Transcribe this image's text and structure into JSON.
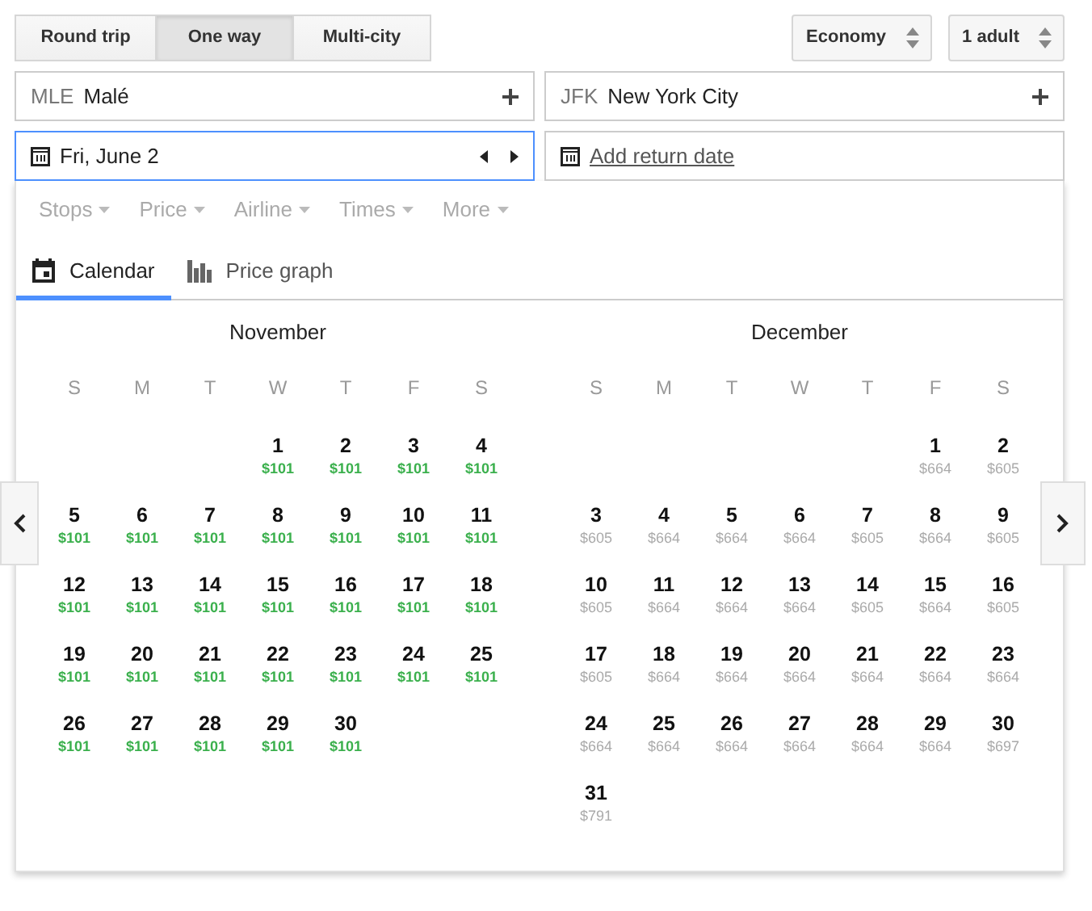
{
  "trip_types": [
    {
      "label": "Round trip",
      "selected": false
    },
    {
      "label": "One way",
      "selected": true
    },
    {
      "label": "Multi-city",
      "selected": false
    }
  ],
  "cabin": "Economy",
  "passengers": "1 adult",
  "origin": {
    "code": "MLE",
    "city": "Malé"
  },
  "destination": {
    "code": "JFK",
    "city": "New York City"
  },
  "depart_date": "Fri, June 2",
  "return_date": "Add return date",
  "filters": [
    "Stops",
    "Price",
    "Airline",
    "Times",
    "More"
  ],
  "view_tabs": [
    {
      "label": "Calendar",
      "kind": "calendar",
      "selected": true
    },
    {
      "label": "Price graph",
      "kind": "graph",
      "selected": false
    }
  ],
  "months": [
    {
      "name": "November",
      "weekdays": [
        "S",
        "M",
        "T",
        "W",
        "T",
        "F",
        "S"
      ],
      "weeks": [
        [
          {
            "day": "1",
            "price": "$101",
            "cheap": true
          },
          {
            "day": "2",
            "price": "$101",
            "cheap": true
          },
          {
            "day": "3",
            "price": "$101",
            "cheap": true
          },
          {
            "day": "4",
            "price": "$101",
            "cheap": true
          }
        ],
        [
          {
            "day": "5",
            "price": "$101",
            "cheap": true
          },
          {
            "day": "6",
            "price": "$101",
            "cheap": true
          },
          {
            "day": "7",
            "price": "$101",
            "cheap": true
          },
          {
            "day": "8",
            "price": "$101",
            "cheap": true
          },
          {
            "day": "9",
            "price": "$101",
            "cheap": true
          },
          {
            "day": "10",
            "price": "$101",
            "cheap": true
          },
          {
            "day": "11",
            "price": "$101",
            "cheap": true
          }
        ],
        [
          {
            "day": "12",
            "price": "$101",
            "cheap": true
          },
          {
            "day": "13",
            "price": "$101",
            "cheap": true
          },
          {
            "day": "14",
            "price": "$101",
            "cheap": true
          },
          {
            "day": "15",
            "price": "$101",
            "cheap": true
          },
          {
            "day": "16",
            "price": "$101",
            "cheap": true
          },
          {
            "day": "17",
            "price": "$101",
            "cheap": true
          },
          {
            "day": "18",
            "price": "$101",
            "cheap": true
          }
        ],
        [
          {
            "day": "19",
            "price": "$101",
            "cheap": true
          },
          {
            "day": "20",
            "price": "$101",
            "cheap": true
          },
          {
            "day": "21",
            "price": "$101",
            "cheap": true
          },
          {
            "day": "22",
            "price": "$101",
            "cheap": true
          },
          {
            "day": "23",
            "price": "$101",
            "cheap": true
          },
          {
            "day": "24",
            "price": "$101",
            "cheap": true
          },
          {
            "day": "25",
            "price": "$101",
            "cheap": true
          }
        ],
        [
          {
            "day": "26",
            "price": "$101",
            "cheap": true
          },
          {
            "day": "27",
            "price": "$101",
            "cheap": true
          },
          {
            "day": "28",
            "price": "$101",
            "cheap": true
          },
          {
            "day": "29",
            "price": "$101",
            "cheap": true
          },
          {
            "day": "30",
            "price": "$101",
            "cheap": true
          }
        ]
      ]
    },
    {
      "name": "December",
      "weekdays": [
        "S",
        "M",
        "T",
        "W",
        "T",
        "F",
        "S"
      ],
      "weeks": [
        [
          {
            "day": "1",
            "price": "$664",
            "cheap": false
          },
          {
            "day": "2",
            "price": "$605",
            "cheap": false
          }
        ],
        [
          {
            "day": "3",
            "price": "$605",
            "cheap": false
          },
          {
            "day": "4",
            "price": "$664",
            "cheap": false
          },
          {
            "day": "5",
            "price": "$664",
            "cheap": false
          },
          {
            "day": "6",
            "price": "$664",
            "cheap": false
          },
          {
            "day": "7",
            "price": "$605",
            "cheap": false
          },
          {
            "day": "8",
            "price": "$664",
            "cheap": false
          },
          {
            "day": "9",
            "price": "$605",
            "cheap": false
          }
        ],
        [
          {
            "day": "10",
            "price": "$605",
            "cheap": false
          },
          {
            "day": "11",
            "price": "$664",
            "cheap": false
          },
          {
            "day": "12",
            "price": "$664",
            "cheap": false
          },
          {
            "day": "13",
            "price": "$664",
            "cheap": false
          },
          {
            "day": "14",
            "price": "$605",
            "cheap": false
          },
          {
            "day": "15",
            "price": "$664",
            "cheap": false
          },
          {
            "day": "16",
            "price": "$605",
            "cheap": false
          }
        ],
        [
          {
            "day": "17",
            "price": "$605",
            "cheap": false
          },
          {
            "day": "18",
            "price": "$664",
            "cheap": false
          },
          {
            "day": "19",
            "price": "$664",
            "cheap": false
          },
          {
            "day": "20",
            "price": "$664",
            "cheap": false
          },
          {
            "day": "21",
            "price": "$664",
            "cheap": false
          },
          {
            "day": "22",
            "price": "$664",
            "cheap": false
          },
          {
            "day": "23",
            "price": "$664",
            "cheap": false
          }
        ],
        [
          {
            "day": "24",
            "price": "$664",
            "cheap": false
          },
          {
            "day": "25",
            "price": "$664",
            "cheap": false
          },
          {
            "day": "26",
            "price": "$664",
            "cheap": false
          },
          {
            "day": "27",
            "price": "$664",
            "cheap": false
          },
          {
            "day": "28",
            "price": "$664",
            "cheap": false
          },
          {
            "day": "29",
            "price": "$664",
            "cheap": false
          },
          {
            "day": "30",
            "price": "$697",
            "cheap": false
          }
        ],
        [
          {
            "day": "31",
            "price": "$791",
            "cheap": false
          }
        ]
      ]
    }
  ]
}
